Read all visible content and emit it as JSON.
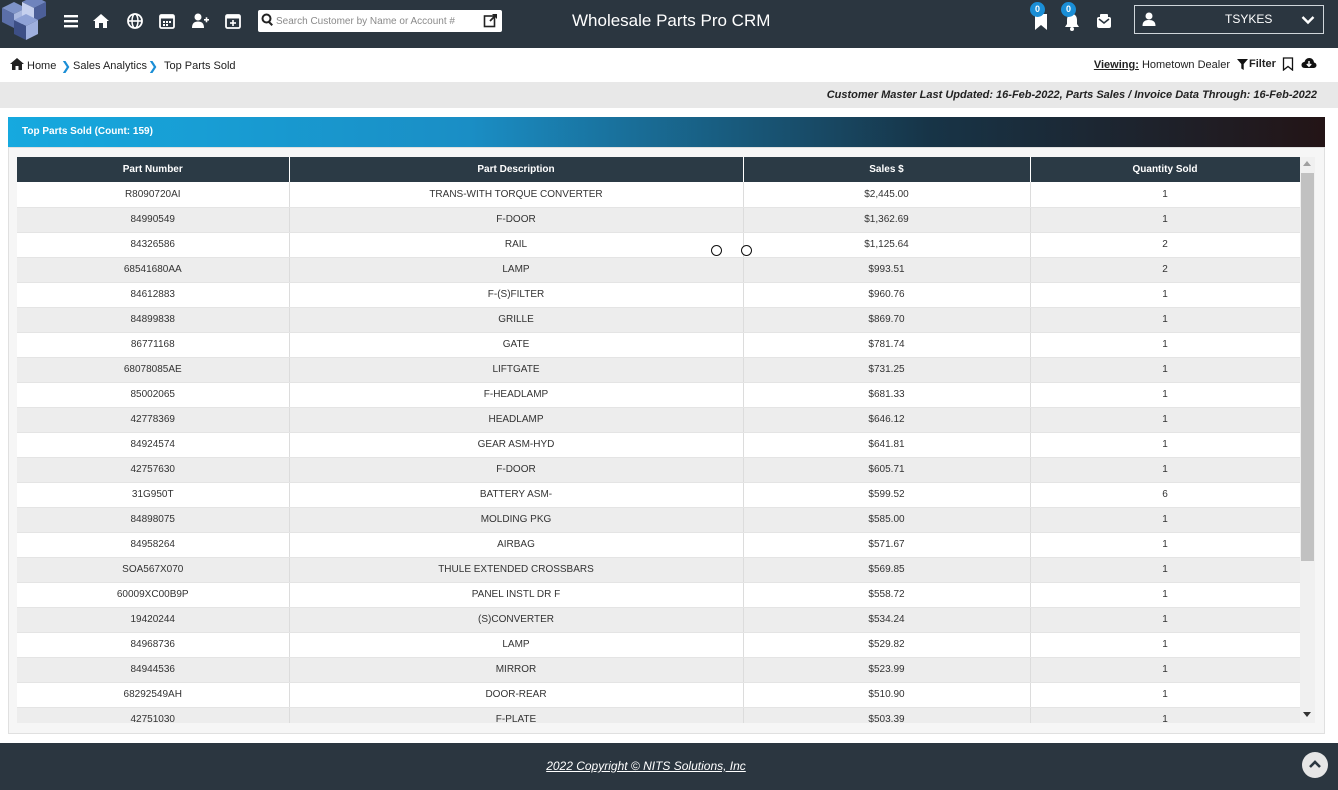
{
  "app": {
    "title": "Wholesale Parts Pro CRM"
  },
  "search": {
    "placeholder": "Search Customer by Name or Account #"
  },
  "header": {
    "user_name": "TSYKES",
    "bookmarks_count": "0",
    "notifications_count": "0"
  },
  "breadcrumb": {
    "home": "Home",
    "sales_analytics": "Sales Analytics",
    "current": "Top Parts Sold"
  },
  "viewing": {
    "label": "Viewing:",
    "value": "Hometown Dealer",
    "filter_label": "Filter"
  },
  "info": {
    "last_updated": "Customer Master Last Updated: 16-Feb-2022, Parts Sales / Invoice Data Through: 16-Feb-2022"
  },
  "panel": {
    "title": "Top Parts Sold (Count: 159)"
  },
  "table": {
    "columns": [
      "Part Number",
      "Part Description",
      "Sales $",
      "Quantity Sold"
    ],
    "rows": [
      [
        "R8090720AI",
        "TRANS-WITH TORQUE CONVERTER",
        "$2,445.00",
        "1"
      ],
      [
        "84990549",
        "F-DOOR",
        "$1,362.69",
        "1"
      ],
      [
        "84326586",
        "RAIL",
        "$1,125.64",
        "2"
      ],
      [
        "68541680AA",
        "LAMP",
        "$993.51",
        "2"
      ],
      [
        "84612883",
        "F-(S)FILTER",
        "$960.76",
        "1"
      ],
      [
        "84899838",
        "GRILLE",
        "$869.70",
        "1"
      ],
      [
        "86771168",
        "GATE",
        "$781.74",
        "1"
      ],
      [
        "68078085AE",
        "LIFTGATE",
        "$731.25",
        "1"
      ],
      [
        "85002065",
        "F-HEADLAMP",
        "$681.33",
        "1"
      ],
      [
        "42778369",
        "HEADLAMP",
        "$646.12",
        "1"
      ],
      [
        "84924574",
        "GEAR ASM-HYD",
        "$641.81",
        "1"
      ],
      [
        "42757630",
        "F-DOOR",
        "$605.71",
        "1"
      ],
      [
        "31G950T",
        "BATTERY ASM-",
        "$599.52",
        "6"
      ],
      [
        "84898075",
        "MOLDING PKG",
        "$585.00",
        "1"
      ],
      [
        "84958264",
        "AIRBAG",
        "$571.67",
        "1"
      ],
      [
        "SOA567X070",
        "THULE EXTENDED CROSSBARS",
        "$569.85",
        "1"
      ],
      [
        "60009XC00B9P",
        "PANEL INSTL DR F",
        "$558.72",
        "1"
      ],
      [
        "19420244",
        "(S)CONVERTER",
        "$534.24",
        "1"
      ],
      [
        "84968736",
        "LAMP",
        "$529.82",
        "1"
      ],
      [
        "84944536",
        "MIRROR",
        "$523.99",
        "1"
      ],
      [
        "68292549AH",
        "DOOR-REAR",
        "$510.90",
        "1"
      ],
      [
        "42751030",
        "F-PLATE",
        "$503.39",
        "1"
      ]
    ]
  },
  "footer": {
    "copyright": "2022 Copyright © NITS Solutions, Inc"
  }
}
